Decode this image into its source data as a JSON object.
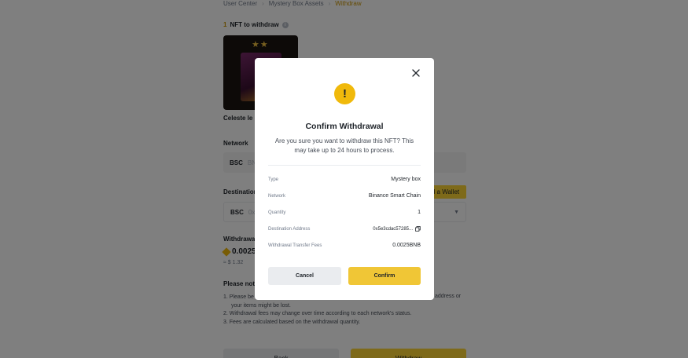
{
  "breadcrumb": [
    "User Center",
    "Mystery Box Assets",
    "Withdraw"
  ],
  "page": {
    "nft_count": "1",
    "nft_to_withdraw_label": "NFT to withdraw",
    "nft_name": "Celeste le C",
    "network_label": "Network",
    "network_value": "BSC",
    "network_placeholder": "BNB",
    "destination_label": "Destination",
    "add_wallet_label": "d a Wallet",
    "destination_network": "BSC",
    "destination_address_preview": "0x5e",
    "withdrawal_fee_label": "Withdrawal",
    "fee_amount": "0.0025",
    "fee_usd": "≈ $ 1.32",
    "please_note_label": "Please note",
    "notes": [
      "1.  Please be",
      "your items might be lost.",
      "2.  Withdrawal fees may change over time according to each network's status.",
      "3.  Fees are calculated based on the withdrawal quantity."
    ],
    "notes_tail": "address or",
    "back_label": "Back",
    "withdraw_label": "Withdraw"
  },
  "modal": {
    "title": "Confirm Withdrawal",
    "description": "Are you sure you want to withdraw this NFT? This may take up to 24 hours to process.",
    "rows": [
      {
        "key": "Type",
        "value": "Mystery box"
      },
      {
        "key": "Network",
        "value": "Binance Smart Chain"
      },
      {
        "key": "Quantity",
        "value": "1"
      },
      {
        "key": "Destination Address",
        "value": "0x5e3cdac57285..."
      },
      {
        "key": "Withdrawal Transfer Fees",
        "value": "0.0025BNB"
      }
    ],
    "cancel_label": "Cancel",
    "confirm_label": "Confirm"
  },
  "colors": {
    "accent": "#f0b90b",
    "confirm_button": "#f0c636",
    "cancel_button": "#eaecef",
    "overlay": "rgba(0,0,0,0.5)"
  },
  "icons": [
    "info-icon",
    "warning-icon",
    "close-icon",
    "copy-icon",
    "bnb-icon",
    "chevron-down-icon"
  ]
}
